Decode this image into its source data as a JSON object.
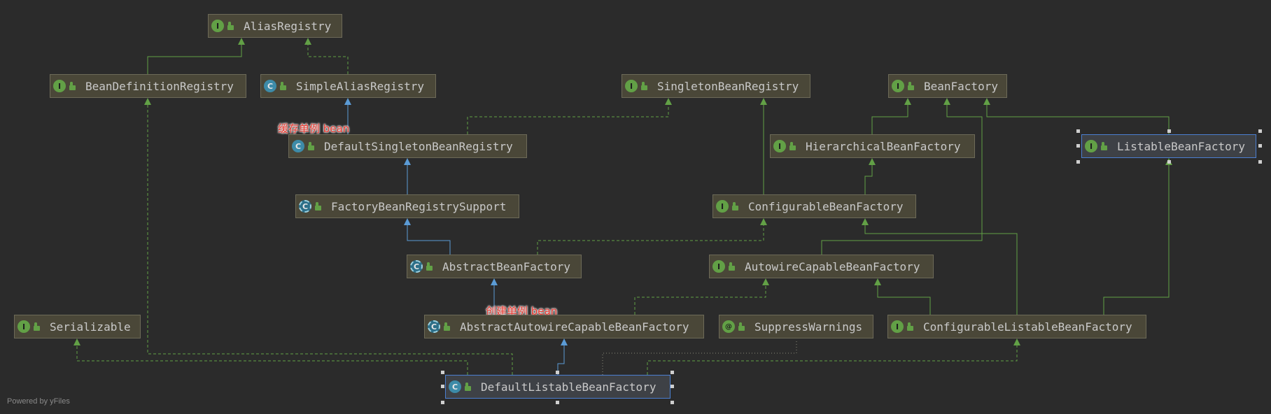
{
  "nodes": {
    "alias_registry": {
      "name": "AliasRegistry",
      "kind": "I"
    },
    "bean_definition_registry": {
      "name": "BeanDefinitionRegistry",
      "kind": "I"
    },
    "simple_alias_registry": {
      "name": "SimpleAliasRegistry",
      "kind": "C"
    },
    "singleton_bean_registry": {
      "name": "SingletonBeanRegistry",
      "kind": "I"
    },
    "bean_factory": {
      "name": "BeanFactory",
      "kind": "I"
    },
    "default_singleton_bean_registry": {
      "name": "DefaultSingletonBeanRegistry",
      "kind": "C"
    },
    "hierarchical_bean_factory": {
      "name": "HierarchicalBeanFactory",
      "kind": "I"
    },
    "listable_bean_factory": {
      "name": "ListableBeanFactory",
      "kind": "I"
    },
    "factory_bean_registry_support": {
      "name": "FactoryBeanRegistrySupport",
      "kind": "C"
    },
    "configurable_bean_factory": {
      "name": "ConfigurableBeanFactory",
      "kind": "I"
    },
    "abstract_bean_factory": {
      "name": "AbstractBeanFactory",
      "kind": "C"
    },
    "autowire_capable_bean_factory": {
      "name": "AutowireCapableBeanFactory",
      "kind": "I"
    },
    "serializable": {
      "name": "Serializable",
      "kind": "I"
    },
    "abstract_autowire_capable_bean_factory": {
      "name": "AbstractAutowireCapableBeanFactory",
      "kind": "C"
    },
    "suppress_warnings": {
      "name": "SuppressWarnings",
      "kind": "@"
    },
    "configurable_listable_bean_factory": {
      "name": "ConfigurableListableBeanFactory",
      "kind": "I"
    },
    "default_listable_bean_factory": {
      "name": "DefaultListableBeanFactory",
      "kind": "C"
    }
  },
  "annotations": {
    "cache_singleton": "缓存单例 bean",
    "create_singleton": "创建单例 bean"
  },
  "footer": "Powered by yFiles",
  "colors": {
    "background": "#2b2b2b",
    "node_fill": "#4a4738",
    "extends_edge": "#5b9bd5",
    "implements_edge": "#62a046",
    "annotation_text": "#e8372e",
    "selection": "#4b7fd1"
  }
}
